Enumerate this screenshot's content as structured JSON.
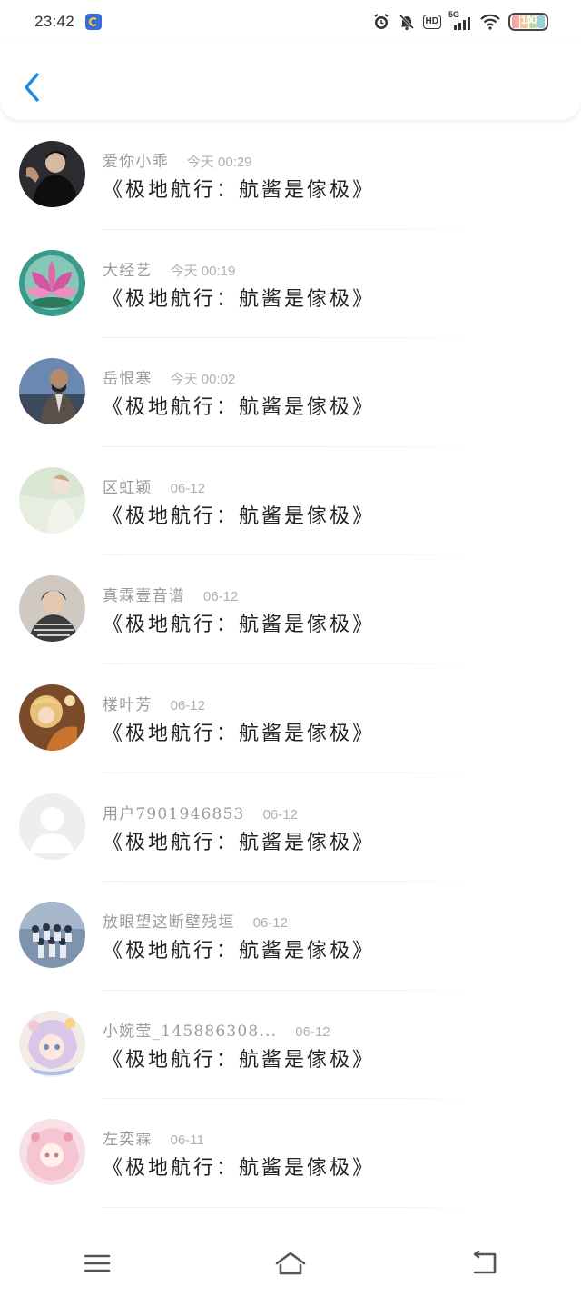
{
  "status_bar": {
    "time": "23:42",
    "network": "5G",
    "hd_label": "HD",
    "battery_label": "100"
  },
  "header": {
    "back_icon": "chevron-left-icon",
    "accent_color": "#1e88e5"
  },
  "items": [
    {
      "name": "爱你小乖",
      "time": "今天 00:29",
      "message": "《极地航行：航酱是傢极》"
    },
    {
      "name": "大经艺",
      "time": "今天 00:19",
      "message": "《极地航行：航酱是傢极》"
    },
    {
      "name": "岳恨寒",
      "time": "今天 00:02",
      "message": "《极地航行：航酱是傢极》"
    },
    {
      "name": "区虹颖",
      "time": "06-12",
      "message": "《极地航行：航酱是傢极》"
    },
    {
      "name": "真霖壹音谱",
      "time": "06-12",
      "message": "《极地航行：航酱是傢极》"
    },
    {
      "name": "楼叶芳",
      "time": "06-12",
      "message": "《极地航行：航酱是傢极》"
    },
    {
      "name": "用户7901946853",
      "time": "06-12",
      "message": "《极地航行：航酱是傢极》"
    },
    {
      "name": "放眼望这断壁残垣",
      "time": "06-12",
      "message": "《极地航行：航酱是傢极》"
    },
    {
      "name": "小婉莹_145886308...",
      "time": "06-12",
      "message": "《极地航行：航酱是傢极》"
    },
    {
      "name": "左奕霖",
      "time": "06-11",
      "message": "《极地航行：航酱是傢极》"
    }
  ],
  "nav": {
    "menu_icon": "menu-icon",
    "home_icon": "home-icon",
    "back_icon": "back-icon"
  }
}
